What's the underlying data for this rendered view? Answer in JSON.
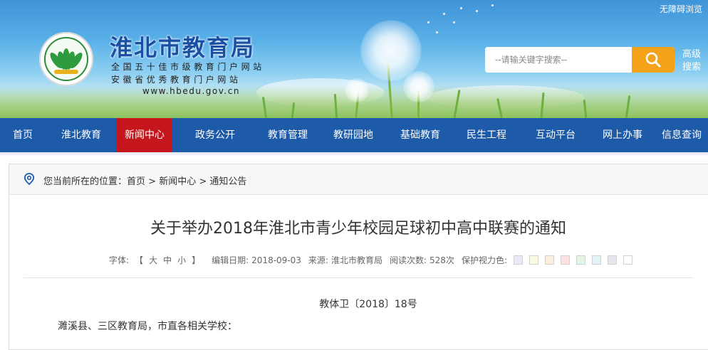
{
  "header": {
    "site_title": "淮北市教育局",
    "subtitle_1": "全国五十佳市级教育门户网站",
    "subtitle_2": "安徽省优秀教育门户网站",
    "website": "www.hbedu.gov.cn",
    "accessible_label": "无障碍浏览",
    "search_placeholder": "--请输关键字搜索--",
    "advanced_search": "高级搜索",
    "search_icon": "magnifier-icon",
    "logo_icon": "education-bureau-emblem"
  },
  "nav": {
    "items": [
      {
        "label": "首页",
        "active": false
      },
      {
        "label": "淮北教育",
        "active": false
      },
      {
        "label": "新闻中心",
        "active": true
      },
      {
        "label": "政务公开",
        "active": false
      },
      {
        "label": "教育管理",
        "active": false
      },
      {
        "label": "教研园地",
        "active": false
      },
      {
        "label": "基础教育",
        "active": false
      },
      {
        "label": "民生工程",
        "active": false
      },
      {
        "label": "互动平台",
        "active": false
      },
      {
        "label": "网上办事",
        "active": false
      },
      {
        "label": "信息查询",
        "active": false
      }
    ]
  },
  "breadcrumb": {
    "prefix": "您当前所在的位置：",
    "home": "首页",
    "sep": " > ",
    "level1": "新闻中心",
    "level2": "通知公告",
    "icon": "location-pin-icon"
  },
  "article": {
    "title": "关于举办2018年淮北市青少年校园足球初中高中联赛的通知",
    "font_label": "字体:",
    "bracket_open": "【",
    "size_large": "大",
    "size_medium": "中",
    "size_small": "小",
    "bracket_close": "】",
    "date_label": "编辑日期:",
    "date": "2018-09-03",
    "source_label": "来源:",
    "source": "淮北市教育局",
    "views_label": "阅读次数:",
    "views": "528次",
    "eye_color_label": "保护视力色:",
    "eye_colors": [
      "#eaeaf4",
      "#fafae2",
      "#fbede0",
      "#fbe3e3",
      "#e4f6e4",
      "#e4f3f6",
      "#e6e6ec",
      "#ffffff"
    ],
    "doc_number": "教体卫〔2018〕18号",
    "salutation": "濉溪县、三区教育局，市直各相关学校："
  },
  "colors": {
    "nav_bg": "#1d5aa8",
    "nav_active": "#c4161c",
    "title_blue": "#1b4fa3",
    "search_button": "#f5a21b"
  }
}
